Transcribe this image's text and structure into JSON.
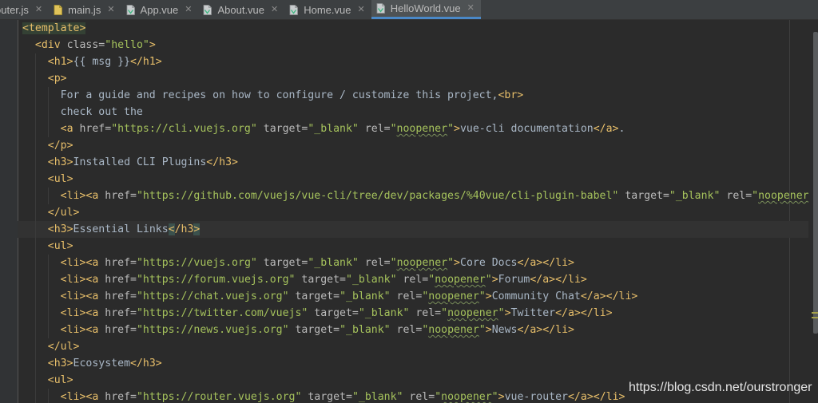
{
  "tabs": [
    {
      "label": "router.js",
      "display": "outer.js",
      "icon": "js-file-icon",
      "active": false
    },
    {
      "label": "main.js",
      "icon": "js-file-icon",
      "active": false
    },
    {
      "label": "App.vue",
      "icon": "vue-file-icon",
      "active": false
    },
    {
      "label": "About.vue",
      "icon": "vue-file-icon",
      "active": false
    },
    {
      "label": "Home.vue",
      "icon": "vue-file-icon",
      "active": false
    },
    {
      "label": "HelloWorld.vue",
      "icon": "vue-file-icon",
      "active": true
    }
  ],
  "colors": {
    "background": "#2b2b2b",
    "tag": "#e8bf6a",
    "string": "#a5c25c",
    "attribute": "#bababa",
    "text": "#a9b7c6",
    "active_tab_underline": "#4a88c7"
  },
  "code_lines": [
    "<template>",
    "  <div class=\"hello\">",
    "    <h1>{{ msg }}</h1>",
    "    <p>",
    "      For a guide and recipes on how to configure / customize this project,<br>",
    "      check out the",
    "      <a href=\"https://cli.vuejs.org\" target=\"_blank\" rel=\"noopener\">vue-cli documentation</a>.",
    "    </p>",
    "    <h3>Installed CLI Plugins</h3>",
    "    <ul>",
    "      <li><a href=\"https://github.com/vuejs/vue-cli/tree/dev/packages/%40vue/cli-plugin-babel\" target=\"_blank\" rel=\"noopener\"",
    "    </ul>",
    "    <h3>Essential Links</h3>",
    "    <ul>",
    "      <li><a href=\"https://vuejs.org\" target=\"_blank\" rel=\"noopener\">Core Docs</a></li>",
    "      <li><a href=\"https://forum.vuejs.org\" target=\"_blank\" rel=\"noopener\">Forum</a></li>",
    "      <li><a href=\"https://chat.vuejs.org\" target=\"_blank\" rel=\"noopener\">Community Chat</a></li>",
    "      <li><a href=\"https://twitter.com/vuejs\" target=\"_blank\" rel=\"noopener\">Twitter</a></li>",
    "      <li><a href=\"https://news.vuejs.org\" target=\"_blank\" rel=\"noopener\">News</a></li>",
    "    </ul>",
    "    <h3>Ecosystem</h3>",
    "    <ul>",
    "      <li><a href=\"https://router.vuejs.org\" target=\"_blank\" rel=\"noopener\">vue-router</a></li>"
  ],
  "current_line": 12,
  "watermark": "https://blog.csdn.net/ourstronger"
}
